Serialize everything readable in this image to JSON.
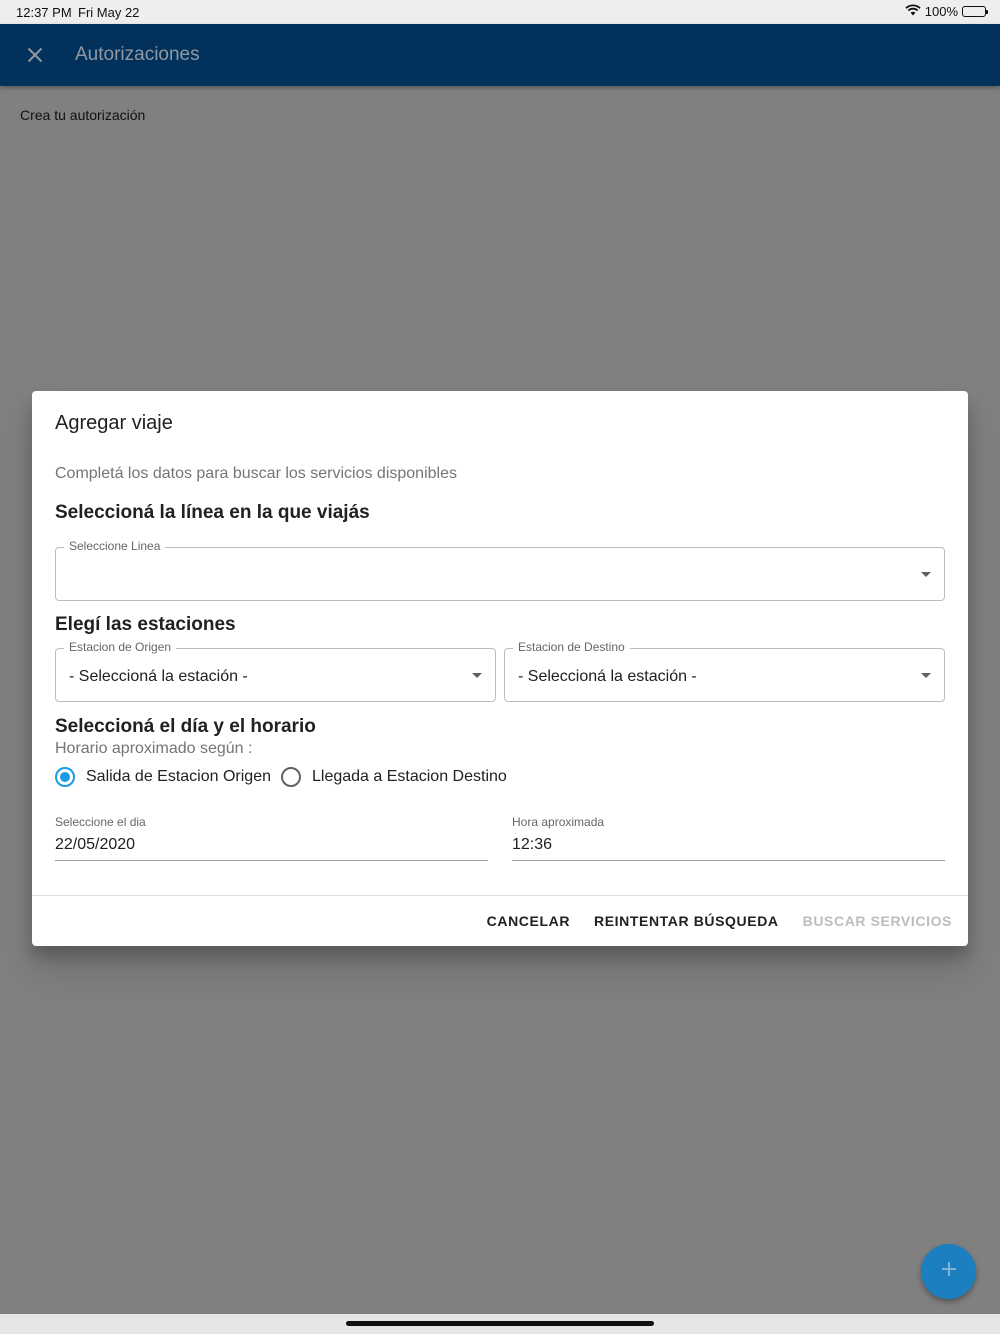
{
  "status_bar": {
    "time": "12:37 PM",
    "date": "Fri May 22",
    "battery": "100%"
  },
  "app_bar": {
    "title": "Autorizaciones"
  },
  "page": {
    "subtitle": "Crea tu autorización"
  },
  "dialog": {
    "title": "Agregar viaje",
    "description": "Completá los datos para buscar los servicios disponibles",
    "line_section": {
      "heading": "Seleccioná la línea en la que viajás",
      "select_label": "Seleccione Linea",
      "select_value": ""
    },
    "stations_section": {
      "heading": "Elegí las estaciones",
      "origin_label": "Estacion de Origen",
      "origin_value": "- Seleccioná la estación -",
      "destination_label": "Estacion de Destino",
      "destination_value": "- Seleccioná la estación -"
    },
    "schedule_section": {
      "heading": "Seleccioná el día y el horario",
      "hint": "Horario aproximado según :",
      "radio_origin": "Salida de Estacion Origen",
      "radio_destination": "Llegada a Estacion Destino",
      "selected": "origin",
      "date_label": "Seleccione el dia",
      "date_value": "22/05/2020",
      "time_label": "Hora aproximada",
      "time_value": "12:36"
    },
    "actions": {
      "cancel": "CANCELAR",
      "retry": "REINTENTAR BÚSQUEDA",
      "search": "BUSCAR SERVICIOS"
    }
  },
  "colors": {
    "app_bar": "#02325b",
    "accent": "#1a9be6",
    "fab": "#1c7fbf",
    "scrim": "#808080"
  }
}
